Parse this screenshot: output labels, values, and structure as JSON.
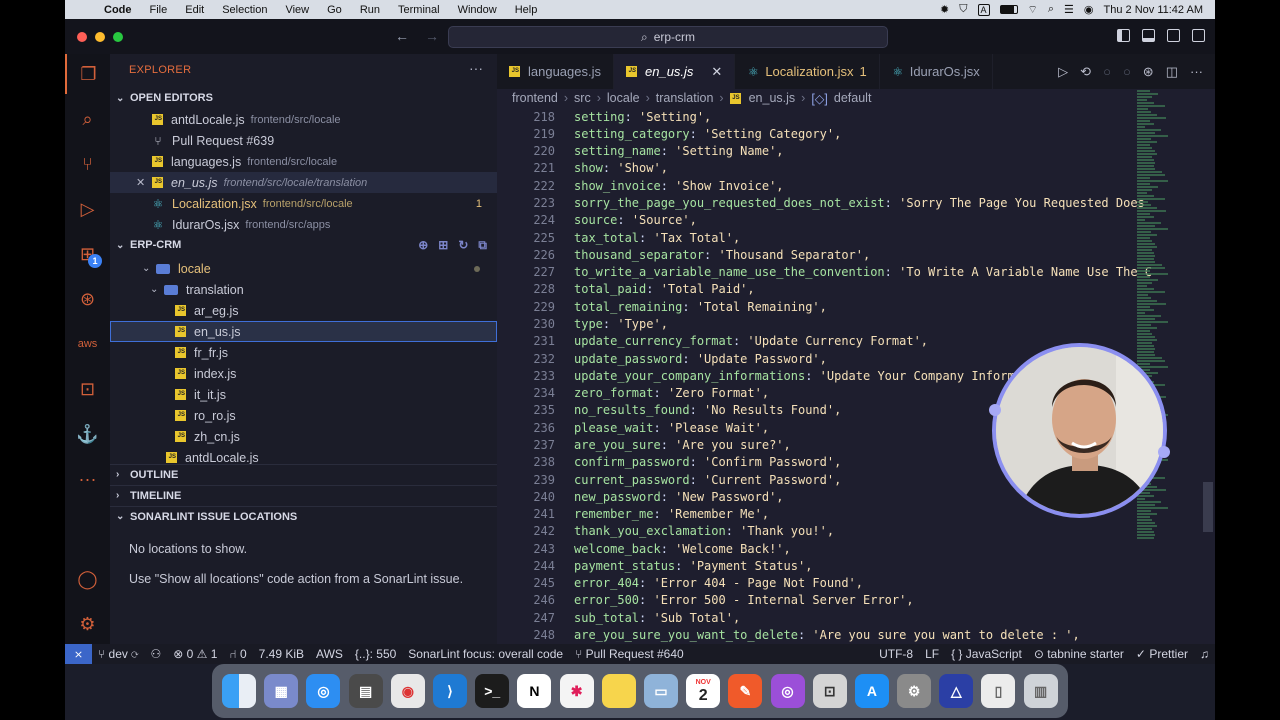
{
  "menubar": {
    "items": [
      "Code",
      "File",
      "Edit",
      "Selection",
      "View",
      "Go",
      "Run",
      "Terminal",
      "Window",
      "Help"
    ],
    "datetime": "Thu 2 Nov  11:42 AM",
    "a_glyph": "A"
  },
  "titlebar": {
    "search_text": "erp-crm"
  },
  "activity": {
    "extensions_badge": "1"
  },
  "sidebar": {
    "title": "EXPLORER",
    "open_editors": {
      "header": "OPEN EDITORS",
      "items": [
        {
          "name": "antdLocale.js",
          "path": "frontend/src/locale"
        },
        {
          "name": "Pull Request #639",
          "path": ""
        },
        {
          "name": "languages.js",
          "path": "frontend/src/locale"
        },
        {
          "name": "en_us.js",
          "path": "frontend/src/locale/translation"
        },
        {
          "name": "Localization.jsx",
          "path": "frontend/src/locale",
          "badge": "1"
        },
        {
          "name": "IdurarOs.jsx",
          "path": "frontend/src/apps"
        }
      ]
    },
    "project": {
      "header": "ERP-CRM",
      "tree": [
        {
          "name": "locale"
        },
        {
          "name": "translation"
        },
        {
          "name": "ar_eg.js"
        },
        {
          "name": "en_us.js"
        },
        {
          "name": "fr_fr.js"
        },
        {
          "name": "index.js"
        },
        {
          "name": "it_it.js"
        },
        {
          "name": "ro_ro.js"
        },
        {
          "name": "zh_cn.js"
        },
        {
          "name": "antdLocale.js"
        }
      ]
    },
    "outline": "OUTLINE",
    "timeline": "TIMELINE",
    "sonar": {
      "header": "SONARLINT ISSUE LOCATIONS",
      "msg1": "No locations to show.",
      "msg2": "Use \"Show all locations\" code action from a SonarLint issue."
    }
  },
  "tabs": [
    {
      "label": "languages.js",
      "type": "js"
    },
    {
      "label": "en_us.js",
      "type": "js",
      "active": true
    },
    {
      "label": "Localization.jsx",
      "type": "react",
      "badge": "1"
    },
    {
      "label": "IdurarOs.jsx",
      "type": "react"
    }
  ],
  "breadcrumb": [
    "frontend",
    "src",
    "locale",
    "translation",
    "en_us.js",
    "default"
  ],
  "code": [
    {
      "n": "218",
      "k": "setting",
      "v": "'Setting',"
    },
    {
      "n": "219",
      "k": "setting_category",
      "v": "'Setting Category',"
    },
    {
      "n": "220",
      "k": "setting_name",
      "v": "'Setting Name',"
    },
    {
      "n": "221",
      "k": "show",
      "v": "'Show',"
    },
    {
      "n": "222",
      "k": "show_invoice",
      "v": "'Show Invoice',"
    },
    {
      "n": "223",
      "k": "sorry_the_page_you_requested_does_not_exist",
      "v": "'Sorry The Page You Requested Does"
    },
    {
      "n": "224",
      "k": "source",
      "v": "'Source',"
    },
    {
      "n": "225",
      "k": "tax_total",
      "v": "'Tax Total',"
    },
    {
      "n": "226",
      "k": "thousand_separator",
      "v": "'Thousand Separator',"
    },
    {
      "n": "227",
      "k": "to_write_a_variable_name_use_the_convention",
      "v": "'To Write A Variable Name Use The C"
    },
    {
      "n": "228",
      "k": "total_paid",
      "v": "'Total Paid',"
    },
    {
      "n": "229",
      "k": "total_remaining",
      "v": "'Total Remaining',"
    },
    {
      "n": "230",
      "k": "type",
      "v": "'Type',"
    },
    {
      "n": "231",
      "k": "update_currency_format",
      "v": "'Update Currency Format',"
    },
    {
      "n": "232",
      "k": "update_password",
      "v": "'Update Password',"
    },
    {
      "n": "233",
      "k": "update_your_company_informations",
      "v": "'Update Your Company Informatio"
    },
    {
      "n": "234",
      "k": "zero_format",
      "v": "'Zero Format',"
    },
    {
      "n": "235",
      "k": "no_results_found",
      "v": "'No Results Found',"
    },
    {
      "n": "236",
      "k": "please_wait",
      "v": "'Please Wait',"
    },
    {
      "n": "237",
      "k": "are_you_sure",
      "v": "'Are you sure?',"
    },
    {
      "n": "238",
      "k": "confirm_password",
      "v": "'Confirm Password',"
    },
    {
      "n": "239",
      "k": "current_password",
      "v": "'Current Password',"
    },
    {
      "n": "240",
      "k": "new_password",
      "v": "'New Password',"
    },
    {
      "n": "241",
      "k": "remember_me",
      "v": "'Remember Me',"
    },
    {
      "n": "242",
      "k": "thank_you_exclamation",
      "v": "'Thank you!',"
    },
    {
      "n": "243",
      "k": "welcome_back",
      "v": "'Welcome Back!',"
    },
    {
      "n": "244",
      "k": "payment_status",
      "v": "'Payment Status',"
    },
    {
      "n": "245",
      "k": "error_404",
      "v": "'Error 404 - Page Not Found',"
    },
    {
      "n": "246",
      "k": "error_500",
      "v": "'Error 500 - Internal Server Error',"
    },
    {
      "n": "247",
      "k": "sub_total",
      "v": "'Sub Total',"
    },
    {
      "n": "248",
      "k": "are_you_sure_you_want_to_delete",
      "v": "'Are you sure you want to delete : ',"
    }
  ],
  "statusbar": {
    "branch": "dev",
    "errors": "0",
    "warnings": "1",
    "ports": "0",
    "size": "7.49 KiB",
    "aws": "AWS",
    "selection": "{..}: 550",
    "sonar": "SonarLint focus: overall code",
    "pr": "Pull Request #640",
    "encoding": "UTF-8",
    "eol": "LF",
    "lang": "{ } JavaScript",
    "tabnine": "tabnine starter",
    "prettier": "Prettier"
  },
  "dock": {
    "calendar_month": "NOV",
    "calendar_day": "2",
    "notion_letter": "N",
    "apps": [
      "finder",
      "launchpad",
      "safari",
      "calculator",
      "chrome",
      "vscode",
      "terminal",
      "notion",
      "slack",
      "notes",
      "preview",
      "calendar",
      "pencil",
      "podcasts",
      "screenshot",
      "appstore",
      "system-settings",
      "affinity",
      "document",
      "trash"
    ]
  },
  "colors": {
    "accent_orange": "#e46d3e",
    "remote_blue": "#3b66c9",
    "key_green": "#a6e3a1",
    "string_cream": "#f5e0b8"
  }
}
